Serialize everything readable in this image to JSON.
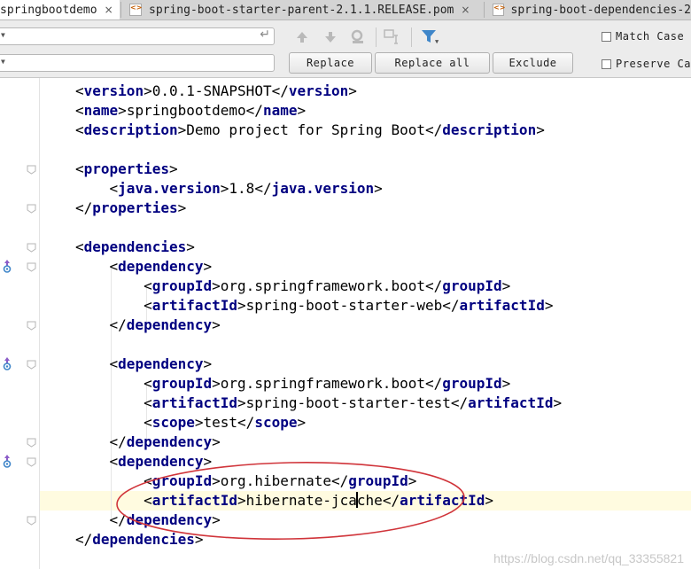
{
  "tabs": [
    {
      "label": "springbootdemo",
      "active": true,
      "close": "×"
    },
    {
      "label": "spring-boot-starter-parent-2.1.1.RELEASE.pom",
      "active": false,
      "close": "×"
    },
    {
      "label": "spring-boot-dependencies-2",
      "active": false,
      "close": ""
    }
  ],
  "find": {
    "search_value": "",
    "replace_value": "",
    "replace_label": "Replace",
    "replace_all_label": "Replace all",
    "exclude_label": "Exclude",
    "match_case_label": "Match Case",
    "preserve_case_label": "Preserve Ca"
  },
  "code": {
    "lines": [
      {
        "t": "<version>0.0.1-SNAPSHOT</version>"
      },
      {
        "t": "<name>springbootdemo</name>"
      },
      {
        "t": "<description>Demo project for Spring Boot</description>"
      },
      {
        "t": ""
      },
      {
        "t": "<properties>"
      },
      {
        "t": "    <java.version>1.8</java.version>"
      },
      {
        "t": "</properties>"
      },
      {
        "t": ""
      },
      {
        "t": "<dependencies>"
      },
      {
        "t": "    <dependency>"
      },
      {
        "t": "        <groupId>org.springframework.boot</groupId>"
      },
      {
        "t": "        <artifactId>spring-boot-starter-web</artifactId>"
      },
      {
        "t": "    </dependency>"
      },
      {
        "t": ""
      },
      {
        "t": "    <dependency>"
      },
      {
        "t": "        <groupId>org.springframework.boot</groupId>"
      },
      {
        "t": "        <artifactId>spring-boot-starter-test</artifactId>"
      },
      {
        "t": "        <scope>test</scope>"
      },
      {
        "t": "    </dependency>"
      },
      {
        "t": "    <dependency>"
      },
      {
        "t": "        <groupId>org.hibernate</groupId>"
      },
      {
        "t": "        <artifactId>hibernate-jcache</artifactId>"
      },
      {
        "t": "    </dependency>"
      },
      {
        "t": "</dependencies>"
      }
    ],
    "caret_line": 21,
    "caret_col": 33
  },
  "watermark": "https://blog.csdn.net/qq_33355821",
  "colors": {
    "tag": "#000080",
    "annotation": "#d0343a",
    "caret_line_bg": "#fffbe0"
  }
}
